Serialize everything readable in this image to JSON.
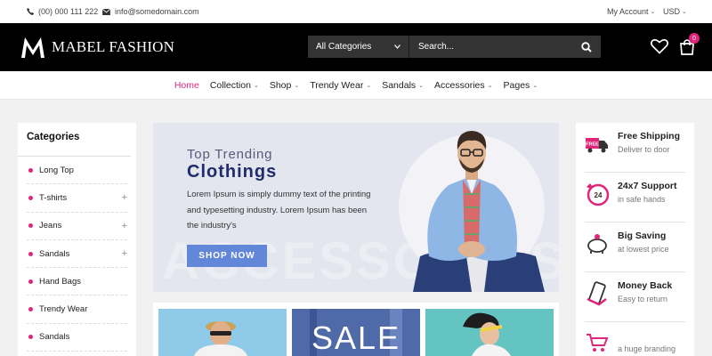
{
  "topbar": {
    "phone": "(00) 000 111 222",
    "email": "info@somedomain.com",
    "account": "My Account",
    "currency": "USD"
  },
  "header": {
    "logo_letter": "M",
    "brand": "MABEL FASHION",
    "search_category": "All Categories",
    "search_placeholder": "Search...",
    "cart_count": "0",
    "accent": "#e0267a"
  },
  "nav": {
    "items": [
      {
        "label": "Home"
      },
      {
        "label": "Collection"
      },
      {
        "label": "Shop"
      },
      {
        "label": "Trendy Wear"
      },
      {
        "label": "Sandals"
      },
      {
        "label": "Accessories"
      },
      {
        "label": "Pages"
      }
    ]
  },
  "categories": {
    "title": "Categories",
    "items": [
      {
        "label": "Long Top"
      },
      {
        "label": "T-shirts"
      },
      {
        "label": "Jeans"
      },
      {
        "label": "Sandals"
      },
      {
        "label": "Hand Bags"
      },
      {
        "label": "Trendy Wear"
      },
      {
        "label": "Sandals"
      }
    ]
  },
  "hero": {
    "line1": "Top Trending",
    "line2": "Clothings",
    "description": "Lorem Ipsum is simply dummy text of the printing and typesetting industry. Lorem Ipsum has been the industry's",
    "button": "SHOP NOW",
    "watermark": "ACCESSORIES"
  },
  "banners": {
    "sale_text": "SALE"
  },
  "services": {
    "items": [
      {
        "title": "Free Shipping",
        "subtitle": "Deliver to door",
        "icon": "truck-icon",
        "badge": "FREE"
      },
      {
        "title": "24x7 Support",
        "subtitle": "in safe hands",
        "icon": "support-24-icon",
        "badge": "24"
      },
      {
        "title": "Big Saving",
        "subtitle": "at lowest price",
        "icon": "piggy-bank-icon"
      },
      {
        "title": "Money Back",
        "subtitle": "Easy to return",
        "icon": "phone-money-icon"
      },
      {
        "title": "",
        "subtitle": "a huge branding",
        "icon": "cart-icon"
      }
    ]
  }
}
